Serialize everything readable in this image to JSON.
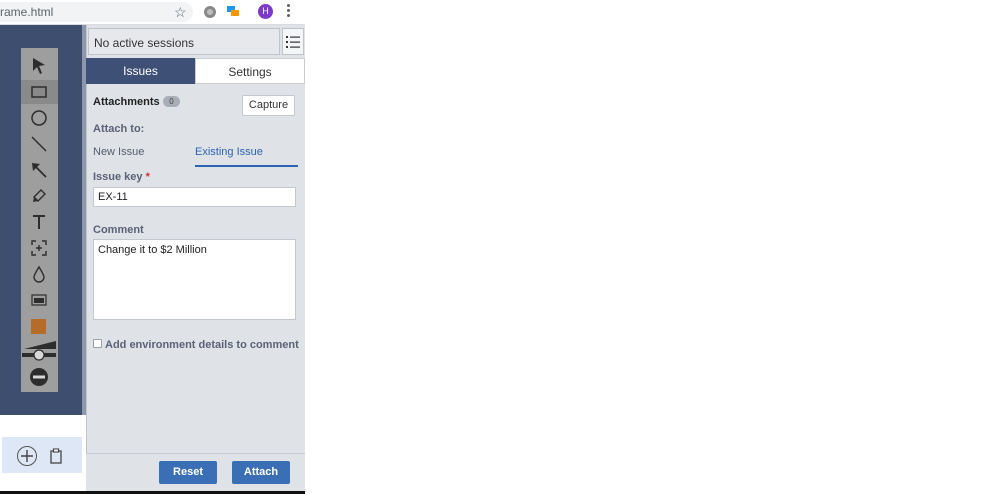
{
  "browser": {
    "url": "rame.html",
    "avatar_initial": "H"
  },
  "sessions": {
    "label": "No active sessions"
  },
  "tabs": [
    {
      "label": "Issues",
      "active": true
    },
    {
      "label": "Settings",
      "active": false
    }
  ],
  "attachments": {
    "title": "Attachments",
    "count": "0",
    "capture_label": "Capture"
  },
  "attach_to": {
    "label": "Attach to:",
    "options": [
      {
        "label": "New Issue",
        "active": false
      },
      {
        "label": "Existing Issue",
        "active": true
      }
    ]
  },
  "issue_key": {
    "label": "Issue key",
    "required_mark": "*",
    "value": "EX-11"
  },
  "comment": {
    "label": "Comment",
    "value": "Change it to $2 Million"
  },
  "env_details": {
    "label": "Add environment details to comment",
    "checked": false
  },
  "footer": {
    "reset_label": "Reset",
    "attach_label": "Attach"
  },
  "tools": [
    "pointer-icon",
    "rectangle-icon",
    "ellipse-icon",
    "line-icon",
    "arrow-icon",
    "pencil-icon",
    "text-icon",
    "crop-icon",
    "blur-icon",
    "highlight-icon",
    "color-swatch-icon",
    "stroke-width-slider",
    "delete-icon"
  ],
  "colors": {
    "panel_bg": "#dfe2e7",
    "tab_active": "#3e5076",
    "canvas_bg": "#3e4e6e",
    "accent": "#3a6fb5",
    "swatch": "#b56b2a"
  }
}
